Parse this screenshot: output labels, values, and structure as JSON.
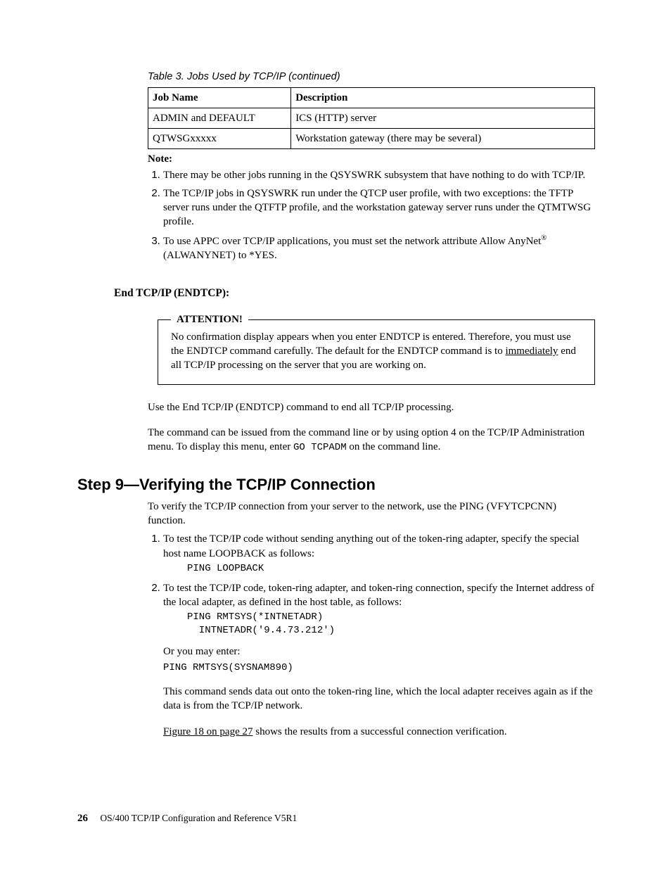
{
  "table": {
    "caption_prefix": "Table 3. Jobs Used by TCP/IP",
    "caption_suffix": " (continued)",
    "headers": {
      "col1": "Job Name",
      "col2": "Description"
    },
    "rows": [
      {
        "name": "ADMIN and DEFAULT",
        "desc": "ICS (HTTP) server"
      },
      {
        "name": "QTWSGxxxxx",
        "desc": "Workstation gateway (there may be several)"
      }
    ]
  },
  "note": {
    "heading": "Note:",
    "items": [
      "There may be other jobs running in the QSYSWRK subsystem that have nothing to do with TCP/IP.",
      "The TCP/IP jobs in QSYSWRK run under the QTCP user profile, with two exceptions: the TFTP server runs under the QTFTP profile, and the workstation gateway server runs under the QTMTWSG profile.",
      "To use APPC over TCP/IP applications, you must set the network attribute Allow AnyNet® (ALWANYNET) to *YES."
    ]
  },
  "endtcp": {
    "heading": "End TCP/IP (ENDTCP):",
    "attention_label": "ATTENTION!",
    "attention_body_pre": "No confirmation display appears when you enter ENDTCP is entered. Therefore, you must use the ENDTCP command carefully. The default for the ENDTCP command is to ",
    "attention_underline": "immediately",
    "attention_body_post": " end all TCP/IP processing on the server that you are working on.",
    "para1": "Use the End TCP/IP (ENDTCP) command to end all TCP/IP processing.",
    "para2_pre": "The command can be issued from the command line or by using option 4 on the TCP/IP Administration menu. To display this menu, enter ",
    "para2_code": "GO TCPADM",
    "para2_post": " on the command line."
  },
  "step9": {
    "heading": "Step 9—Verifying the TCP/IP Connection",
    "intro": "To verify the TCP/IP connection from your server to the network, use the PING (VFYTCPCNN) function.",
    "item1_text": "To test the TCP/IP code without sending anything out of the token-ring adapter, specify the special host name LOOPBACK as follows:",
    "item1_code": "PING LOOPBACK",
    "item2_text": "To test the TCP/IP code, token-ring adapter, and token-ring connection, specify the Internet address of the local adapter, as defined in the host table, as follows:",
    "item2_code": "PING RMTSYS(*INTNETADR)\n  INTNETADR('9.4.73.212')",
    "item2_or": "Or you may enter:",
    "item2_code2": "PING RMTSYS(SYSNAM890)",
    "item2_explain": "This command sends data out onto the token-ring line, which the local adapter receives again as if the data is from the TCP/IP network.",
    "xref": "Figure 18 on page 27",
    "xref_post": " shows the results from a successful connection verification."
  },
  "footer": {
    "page": "26",
    "title": "OS/400 TCP/IP Configuration and Reference V5R1"
  }
}
